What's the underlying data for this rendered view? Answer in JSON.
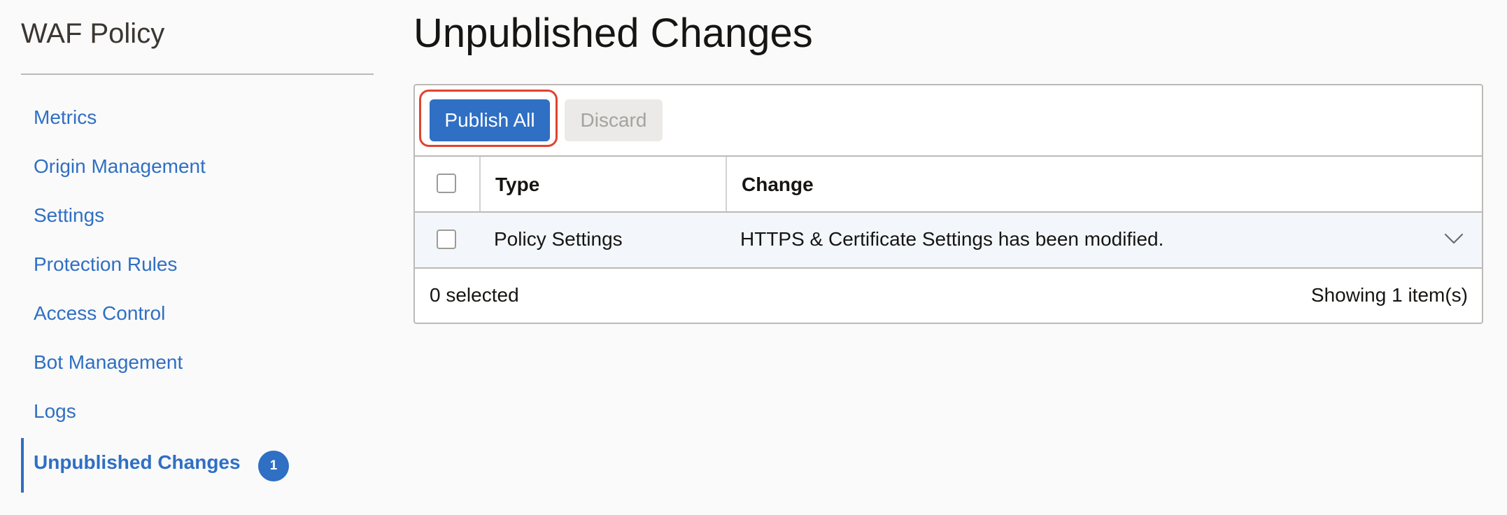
{
  "sidebar": {
    "title": "WAF Policy",
    "items": [
      {
        "label": "Metrics"
      },
      {
        "label": "Origin Management"
      },
      {
        "label": "Settings"
      },
      {
        "label": "Protection Rules"
      },
      {
        "label": "Access Control"
      },
      {
        "label": "Bot Management"
      },
      {
        "label": "Logs"
      },
      {
        "label": "Unpublished Changes",
        "active": true,
        "badge": "1"
      }
    ]
  },
  "main": {
    "title": "Unpublished Changes",
    "toolbar": {
      "publish_label": "Publish All",
      "discard_label": "Discard"
    },
    "table": {
      "columns": [
        "Type",
        "Change"
      ],
      "rows": [
        {
          "type": "Policy Settings",
          "change": "HTTPS & Certificate Settings has been modified."
        }
      ]
    },
    "footer": {
      "selected_text": "0 selected",
      "count_text": "Showing 1 item(s)"
    }
  },
  "colors": {
    "accent": "#2f6fc4",
    "highlight": "#e0442f",
    "row_bg": "#f3f7fc"
  },
  "icons": {
    "row_expand": "chevron-down-icon"
  }
}
